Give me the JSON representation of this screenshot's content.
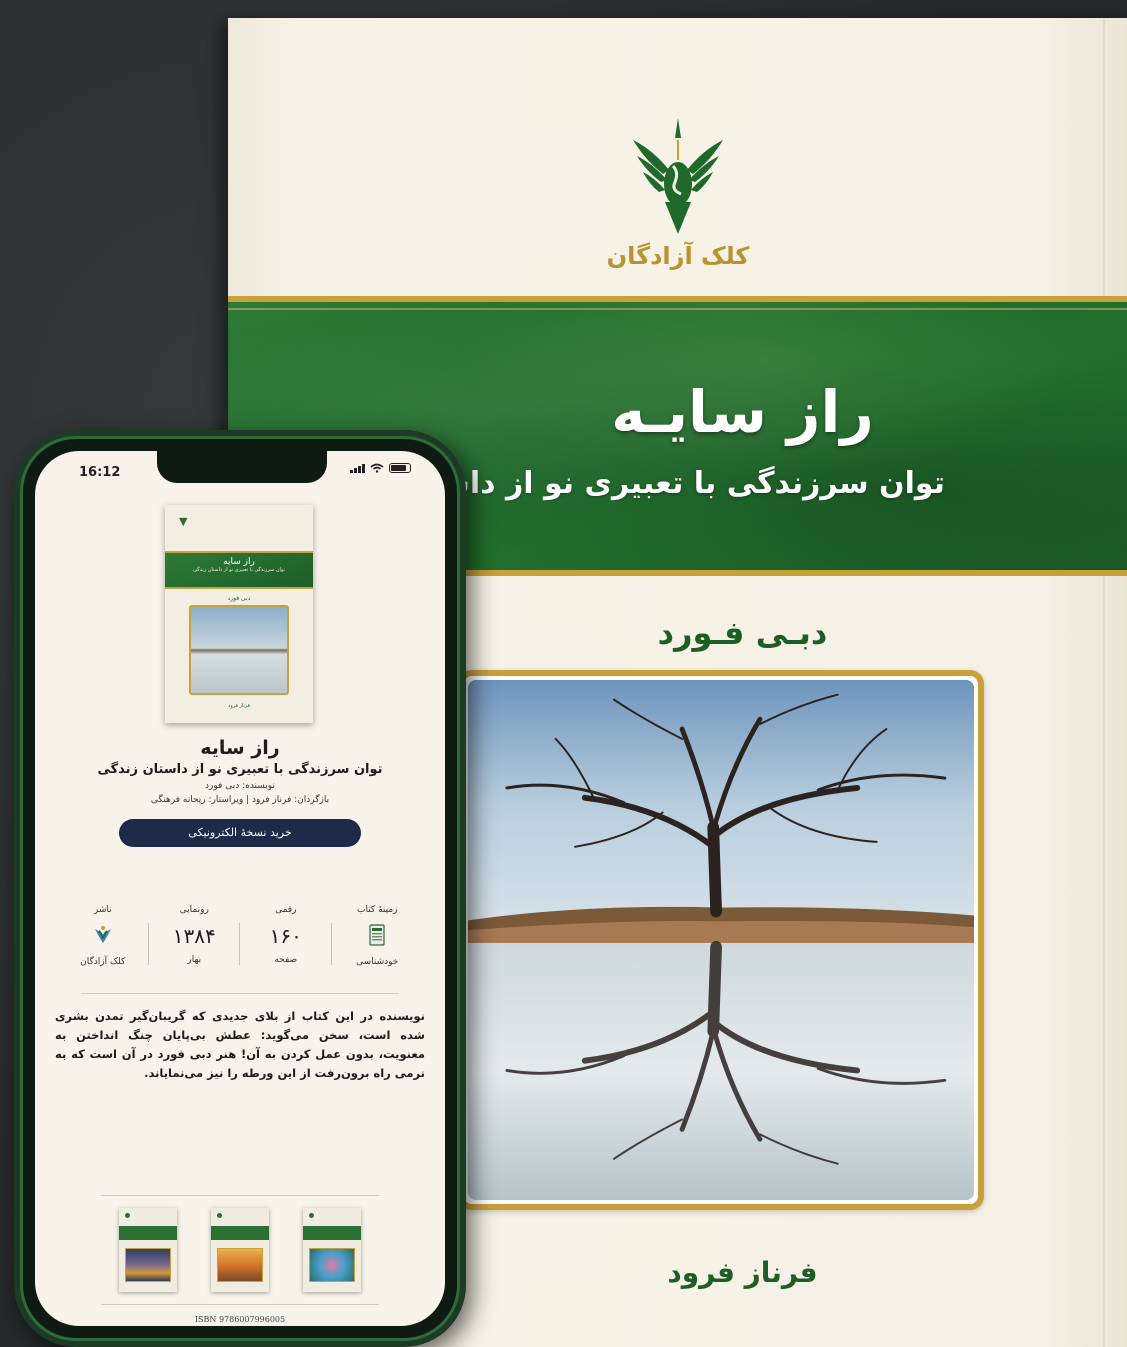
{
  "cover": {
    "publisher_name": "کلک آزادگان",
    "title": "راز سایـه",
    "subtitle": "توان سرزندگی با تعبیری نو از داستان زندگی",
    "author": "دبـی فـورد",
    "translator": "فرناز فرود"
  },
  "phone": {
    "status_time": "16:12",
    "mini_cover": {
      "title": "راز سایه",
      "subtitle": "توان سرزندگی با تعبیری نو از داستان زندگی",
      "author": "دبی فورد",
      "translator": "فرناز فرود"
    },
    "book": {
      "title": "راز سایه",
      "subtitle": "توان سرزندگی با تعبیری نو از داستان زندگی",
      "author_line": "نویسنده: دبی فورد",
      "credits_line": "بازگردان: فرناز فرود | ویراستار: ریحانه فرهنگی"
    },
    "buy_button": "خرید نسخهٔ الکترونیکی",
    "stats": [
      {
        "label": "ناشر",
        "value": "",
        "foot": "کلک آزادگان",
        "kind": "logo"
      },
      {
        "label": "رونمایی",
        "value": "۱۳۸۴",
        "foot": "بهار",
        "kind": "text"
      },
      {
        "label": "رقمی",
        "value": "۱۶۰",
        "foot": "صفحه",
        "kind": "text"
      },
      {
        "label": "زمینهٔ کتاب",
        "value": "",
        "foot": "خودشناسی",
        "kind": "icon"
      }
    ],
    "description": "نویسنده در این کتاب از بلای جدیدی که گریبان‌گیر تمدن بشری شده است، سخن می‌گوید: عطش بی‌پایان چنگ انداختن به معنویت، بدون عمل کردن به آن! هنر دبی فورد در آن است که به نرمی راه برون‌رفت از این ورطه را نیز می‌نمایاند.",
    "isbn": "ISBN 9786007996005"
  },
  "colors": {
    "green": "#1f6a2b",
    "gold": "#c9a13a",
    "navy": "#1e2a4a",
    "cream": "#f6f2e7"
  }
}
